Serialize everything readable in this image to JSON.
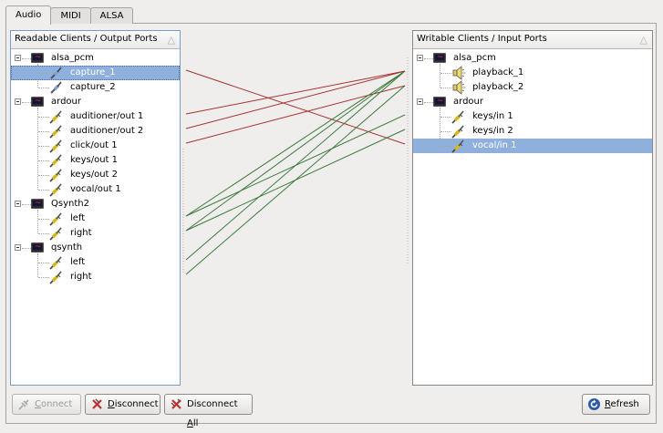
{
  "tabs": [
    {
      "label": "Audio",
      "active": true
    },
    {
      "label": "MIDI",
      "active": false
    },
    {
      "label": "ALSA",
      "active": false
    }
  ],
  "left_panel": {
    "header": "Readable Clients / Output Ports",
    "clients": [
      {
        "name": "alsa_pcm",
        "ports": [
          "capture_1",
          "capture_2"
        ]
      },
      {
        "name": "ardour",
        "ports": [
          "auditioner/out 1",
          "auditioner/out 2",
          "click/out 1",
          "keys/out 1",
          "keys/out 2",
          "vocal/out 1"
        ]
      },
      {
        "name": "Qsynth2",
        "ports": [
          "left",
          "right"
        ]
      },
      {
        "name": "qsynth",
        "ports": [
          "left",
          "right"
        ]
      }
    ],
    "selected": "capture_1"
  },
  "right_panel": {
    "header": "Writable Clients / Input Ports",
    "clients": [
      {
        "name": "alsa_pcm",
        "ports": [
          "playback_1",
          "playback_2"
        ]
      },
      {
        "name": "ardour",
        "ports": [
          "keys/in 1",
          "keys/in 2",
          "vocal/in 1"
        ]
      }
    ],
    "selected": "vocal/in 1"
  },
  "connections_colors": {
    "red": "#a83232",
    "green": "#3a7a3a"
  },
  "buttons": {
    "connect": {
      "pre": "",
      "key": "C",
      "post": "onnect"
    },
    "disconnect": {
      "pre": "",
      "key": "D",
      "post": "isconnect"
    },
    "disconnect_all": {
      "pre": "Disconnect ",
      "key": "A",
      "post": "ll"
    },
    "refresh": {
      "pre": "",
      "key": "R",
      "post": "efresh"
    }
  }
}
